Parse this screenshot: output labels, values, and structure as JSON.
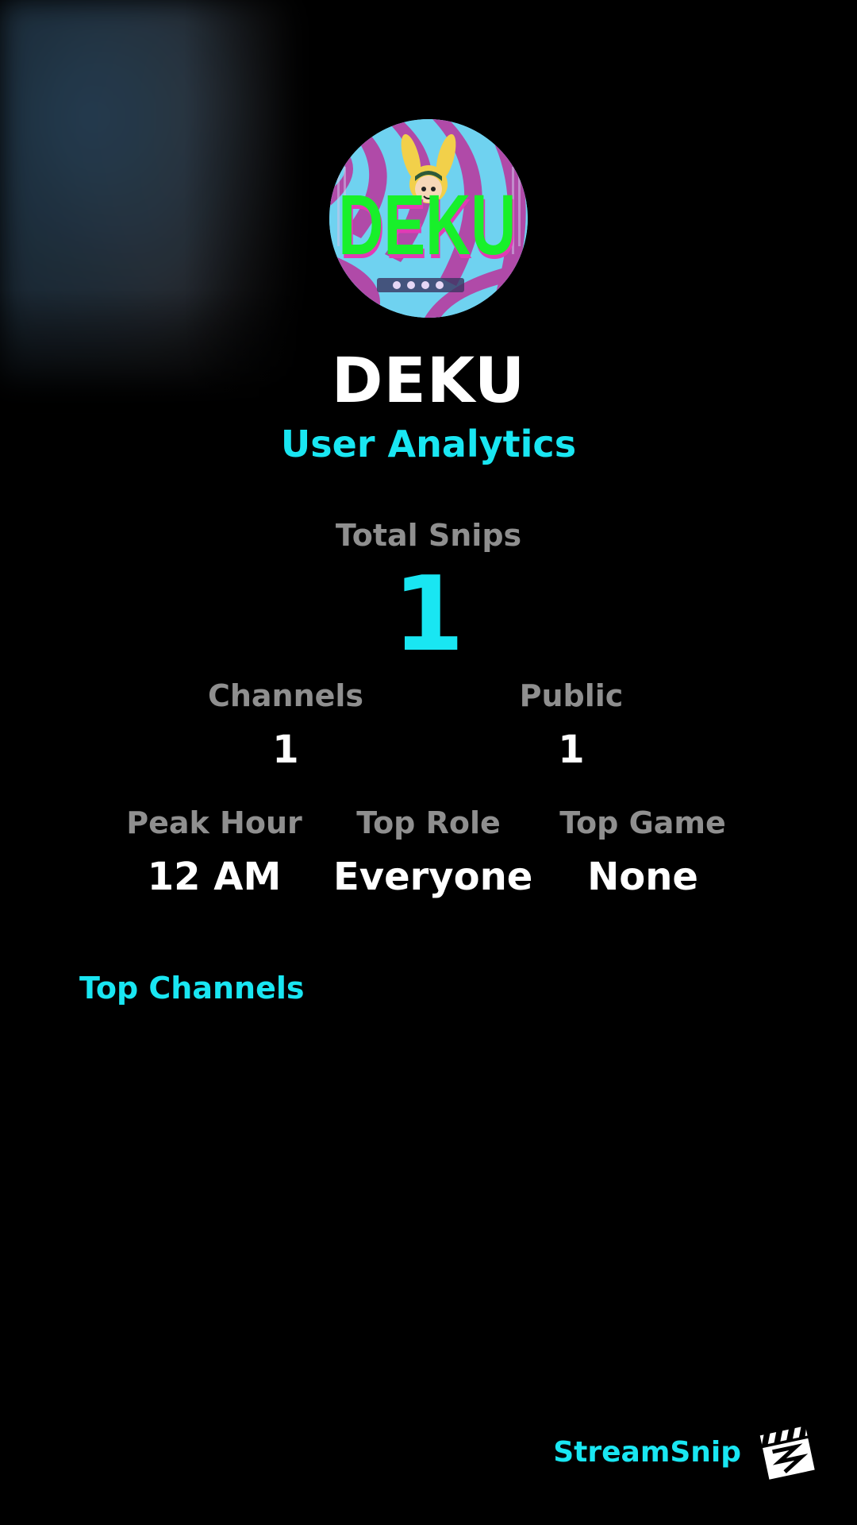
{
  "profile": {
    "avatar_text": "DEKU",
    "username": "DEKU",
    "subtitle": "User Analytics"
  },
  "total": {
    "label": "Total Snips",
    "value": "1"
  },
  "stats_row1": [
    {
      "label": "Channels",
      "value": "1"
    },
    {
      "label": "Public",
      "value": "1"
    }
  ],
  "stats_row2": [
    {
      "label": "Peak Hour",
      "value": "12 AM"
    },
    {
      "label": "Top Role",
      "value": "Everyone"
    },
    {
      "label": "Top Game",
      "value": "None"
    }
  ],
  "sections": {
    "top_channels": "Top Channels"
  },
  "branding": {
    "name": "StreamSnip",
    "logo_icon": "clapperboard-icon"
  },
  "colors": {
    "accent": "#19e6f2",
    "label_gray": "#8f8f8f",
    "background": "#000000"
  }
}
